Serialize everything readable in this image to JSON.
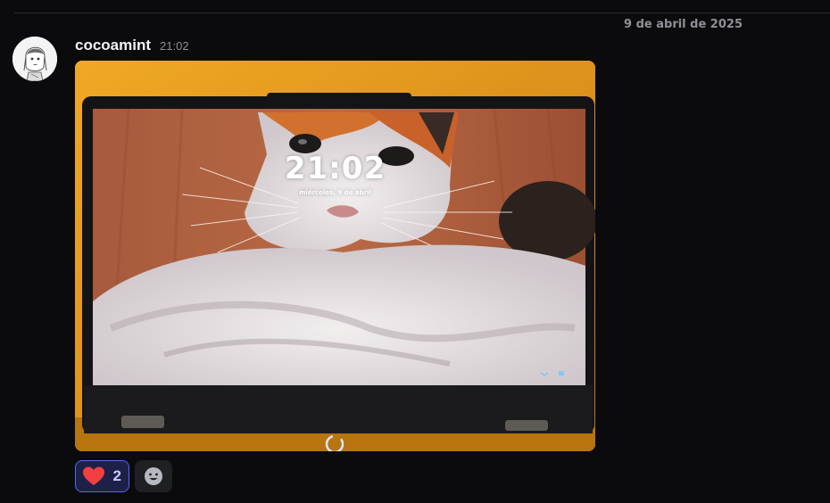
{
  "date_divider": {
    "label": "9 de abril de 2025"
  },
  "message": {
    "author": "cocoamint",
    "timestamp": "21:02",
    "avatar": {
      "icon": "anime-girl-avatar-icon"
    },
    "attachment": {
      "lock_screen_time": "21:02",
      "lock_screen_date": "miércoles, 9 de abril"
    }
  },
  "reactions": {
    "heart": {
      "emoji": "heart-icon",
      "count": "2",
      "color": "#f23f43"
    },
    "add": {
      "icon": "add-reaction-smiley-icon"
    }
  },
  "colors": {
    "background": "#0b0b0e",
    "reaction_active_border": "#5865f2",
    "reaction_active_bg": "#1e2147"
  }
}
